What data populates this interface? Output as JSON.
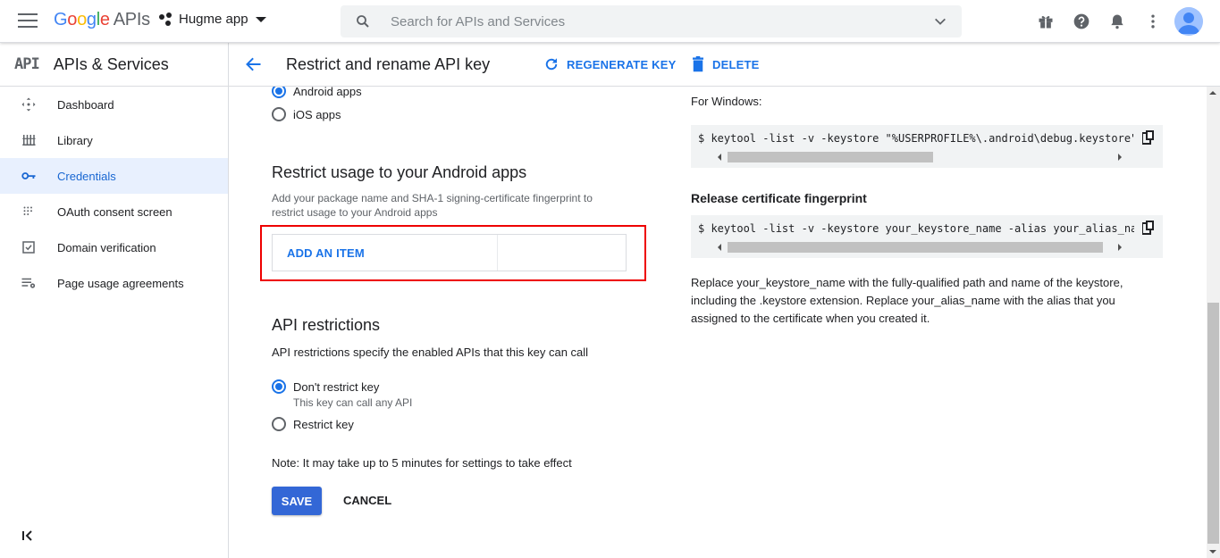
{
  "app": {
    "logo_google": [
      "G",
      "o",
      "o",
      "g",
      "l",
      "e"
    ],
    "logo_suffix": "APIs",
    "project_name": "Hugme app",
    "search_placeholder": "Search for APIs and Services"
  },
  "icons": [
    "menu-icon",
    "search-icon",
    "chevron-down-icon",
    "gift-icon",
    "help-icon",
    "bell-icon",
    "more-vert-icon",
    "avatar-icon",
    "dashboard-icon",
    "library-icon",
    "key-icon",
    "oauth-icon",
    "domain-icon",
    "page-usage-icon",
    "collapse-icon",
    "back-arrow-icon",
    "refresh-icon",
    "trash-icon",
    "copy-icon"
  ],
  "sidebar": {
    "badge": "API",
    "title": "APIs & Services",
    "items": [
      {
        "label": "Dashboard",
        "icon": "dashboard-icon"
      },
      {
        "label": "Library",
        "icon": "library-icon"
      },
      {
        "label": "Credentials",
        "icon": "key-icon",
        "active": true
      },
      {
        "label": "OAuth consent screen",
        "icon": "oauth-icon"
      },
      {
        "label": "Domain verification",
        "icon": "domain-icon"
      },
      {
        "label": "Page usage agreements",
        "icon": "page-usage-icon"
      }
    ]
  },
  "header": {
    "title": "Restrict and rename API key",
    "regenerate_label": "REGENERATE KEY",
    "delete_label": "DELETE"
  },
  "app_restrictions": {
    "android_label": "Android apps",
    "ios_label": "iOS apps",
    "selected": "Android apps"
  },
  "android_section": {
    "title": "Restrict usage to your Android apps",
    "description_line1": "Add your package name and SHA-1 signing-certificate fingerprint to",
    "description_line2": "restrict usage to your Android apps",
    "add_item_label": "ADD AN ITEM"
  },
  "api_restrictions": {
    "title": "API restrictions",
    "description": "API restrictions specify the enabled APIs that this key can call",
    "option_dont_restrict": "Don't restrict key",
    "option_dont_restrict_hint": "This key can call any API",
    "option_restrict": "Restrict key",
    "selected": "Don't restrict key"
  },
  "note": "Note: It may take up to 5 minutes for settings to take effect",
  "actions": {
    "save_label": "SAVE",
    "cancel_label": "CANCEL"
  },
  "right_panel": {
    "windows_label": "For Windows:",
    "windows_command": "$ keytool -list -v -keystore \"%USERPROFILE%\\.android\\debug.keystore\"",
    "release_title": "Release certificate fingerprint",
    "release_command": "$ keytool -list -v -keystore your_keystore_name -alias your_alias_name",
    "explanation": "Replace your_keystore_name with the fully-qualified path and name of the keystore, including the .keystore extension. Replace your_alias_name with the alias that you assigned to the certificate when you created it."
  },
  "colors": {
    "accent": "#1a73e8",
    "save_button": "#3367d6",
    "active_nav_bg": "#e8f0fe",
    "highlight_box": "#ee0000"
  }
}
